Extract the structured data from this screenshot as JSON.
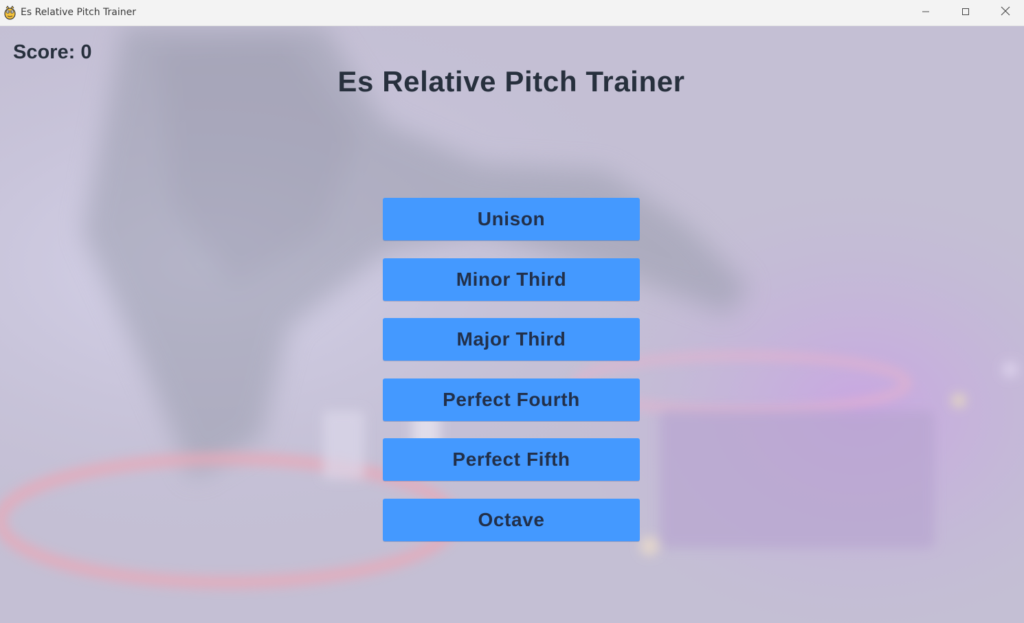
{
  "window": {
    "title": "Es Relative Pitch Trainer",
    "icon": "pygame-snake-icon",
    "controls": [
      "minimize-icon",
      "maximize-icon",
      "close-icon"
    ]
  },
  "game": {
    "score_text": "Score: 0",
    "title": "Es Relative Pitch Trainer",
    "background": "dj-turntable-photo",
    "button_color": "#4499ff",
    "text_color": "#27303d"
  },
  "intervals": [
    {
      "label": "Unison"
    },
    {
      "label": "Minor Third"
    },
    {
      "label": "Major Third"
    },
    {
      "label": "Perfect Fourth"
    },
    {
      "label": "Perfect Fifth"
    },
    {
      "label": "Octave"
    }
  ]
}
